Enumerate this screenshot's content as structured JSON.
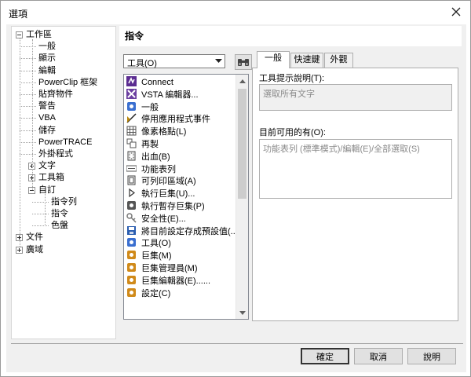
{
  "window": {
    "title": "選項"
  },
  "tree": {
    "items": [
      {
        "label": "工作區",
        "level": 0,
        "expander": "minus"
      },
      {
        "label": "一般",
        "level": 1
      },
      {
        "label": "顯示",
        "level": 1
      },
      {
        "label": "編輯",
        "level": 1
      },
      {
        "label": "PowerClip 框架",
        "level": 1
      },
      {
        "label": "貼齊物件",
        "level": 1
      },
      {
        "label": "警告",
        "level": 1
      },
      {
        "label": "VBA",
        "level": 1
      },
      {
        "label": "儲存",
        "level": 1
      },
      {
        "label": "PowerTRACE",
        "level": 1
      },
      {
        "label": "外掛程式",
        "level": 1
      },
      {
        "label": "文字",
        "level": 1,
        "expander": "plus"
      },
      {
        "label": "工具箱",
        "level": 1,
        "expander": "plus"
      },
      {
        "label": "自訂",
        "level": 1,
        "expander": "minus"
      },
      {
        "label": "指令列",
        "level": 2
      },
      {
        "label": "指令",
        "level": 2,
        "selected": true
      },
      {
        "label": "色盤",
        "level": 2
      },
      {
        "label": "文件",
        "level": 0,
        "expander": "plus"
      },
      {
        "label": "廣域",
        "level": 0,
        "expander": "plus"
      }
    ]
  },
  "panel": {
    "heading": "指令",
    "dropdown_value": "工具(O)",
    "find_icon": "binoculars-icon",
    "commands": [
      {
        "label": "Connect",
        "icon": "connect-icon",
        "color": "#5b2c91"
      },
      {
        "label": "VSTA 編輯器...",
        "icon": "vsta-icon",
        "color": "#6b3fa0"
      },
      {
        "label": "一般",
        "icon": "general-icon",
        "color": "#3a6fd0"
      },
      {
        "label": "停用應用程式事件",
        "icon": "disable-events-icon",
        "color": "#b8860b"
      },
      {
        "label": "像素格點(L)",
        "icon": "pixel-grid-icon",
        "color": "#555555"
      },
      {
        "label": "再製",
        "icon": "duplicate-icon",
        "color": "#555555"
      },
      {
        "label": "出血(B)",
        "icon": "bleed-icon",
        "color": "#444444"
      },
      {
        "label": "功能表列",
        "icon": "menubar-icon",
        "color": "#555555"
      },
      {
        "label": "可列印區域(A)",
        "icon": "printable-area-icon",
        "color": "#444444"
      },
      {
        "label": "執行巨集(U)...",
        "icon": "play-icon",
        "color": "#333333"
      },
      {
        "label": "執行暫存巨集(P)",
        "icon": "run-temp-macro-icon",
        "color": "#555555"
      },
      {
        "label": "安全性(E)...",
        "icon": "security-key-icon",
        "color": "#777777"
      },
      {
        "label": "將目前設定存成預設值(...",
        "icon": "save-default-icon",
        "color": "#2a5db0"
      },
      {
        "label": "工具(O)",
        "icon": "tools-icon",
        "color": "#3a6fd0"
      },
      {
        "label": "巨集(M)",
        "icon": "macro-icon",
        "color": "#d08a1a"
      },
      {
        "label": "巨集管理員(M)",
        "icon": "macro-manager-icon",
        "color": "#d08a1a"
      },
      {
        "label": "巨集編輯器(E)......",
        "icon": "macro-editor-icon",
        "color": "#d08a1a"
      },
      {
        "label": "設定(C)",
        "icon": "settings-icon",
        "color": "#d08a1a"
      }
    ],
    "tabs": [
      {
        "label": "一般",
        "active": true
      },
      {
        "label": "快速鍵",
        "active": false
      },
      {
        "label": "外觀",
        "active": false
      }
    ],
    "tooltip_label": "工具提示說明(T):",
    "tooltip_value": "選取所有文字",
    "available_label": "目前可用的有(O):",
    "available_value": "功能表列 (標準模式)/編輯(E)/全部選取(S)"
  },
  "buttons": {
    "ok": "確定",
    "cancel": "取消",
    "help": "說明"
  }
}
